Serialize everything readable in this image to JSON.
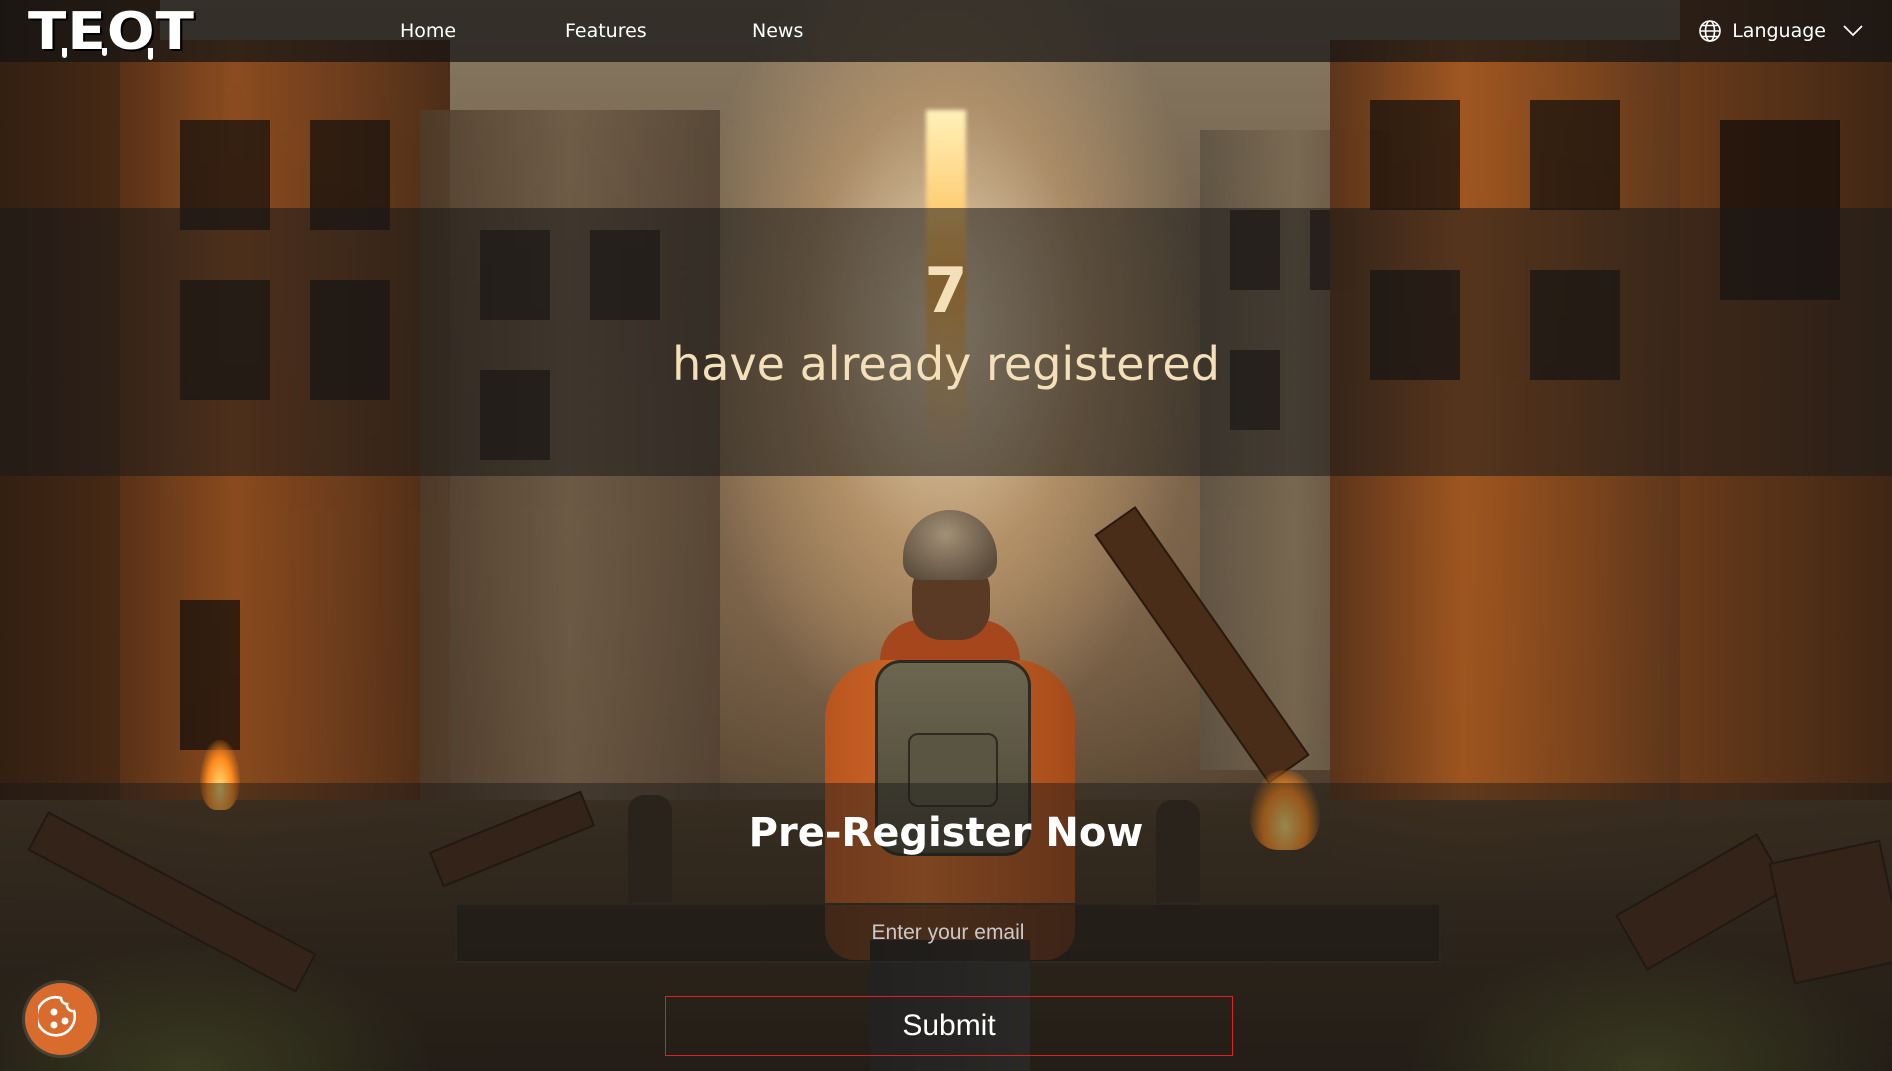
{
  "brand": {
    "logo_text": "TEOT"
  },
  "nav": {
    "items": [
      {
        "label": "Home"
      },
      {
        "label": "Features"
      },
      {
        "label": "News"
      }
    ],
    "language_label": "Language",
    "language_icon": "globe-icon",
    "dropdown_icon": "chevron-down-icon"
  },
  "counter": {
    "value": "7",
    "label": "have already registered"
  },
  "register": {
    "title": "Pre-Register Now",
    "email_placeholder": "Enter your email",
    "email_value": "",
    "submit_label": "Submit"
  },
  "cookie": {
    "icon": "cookie-icon"
  },
  "colors": {
    "nav_bg": "#141414",
    "counter_text": "#f3dfb8",
    "submit_border": "#e02020",
    "cookie_button": "#d96c2c"
  }
}
